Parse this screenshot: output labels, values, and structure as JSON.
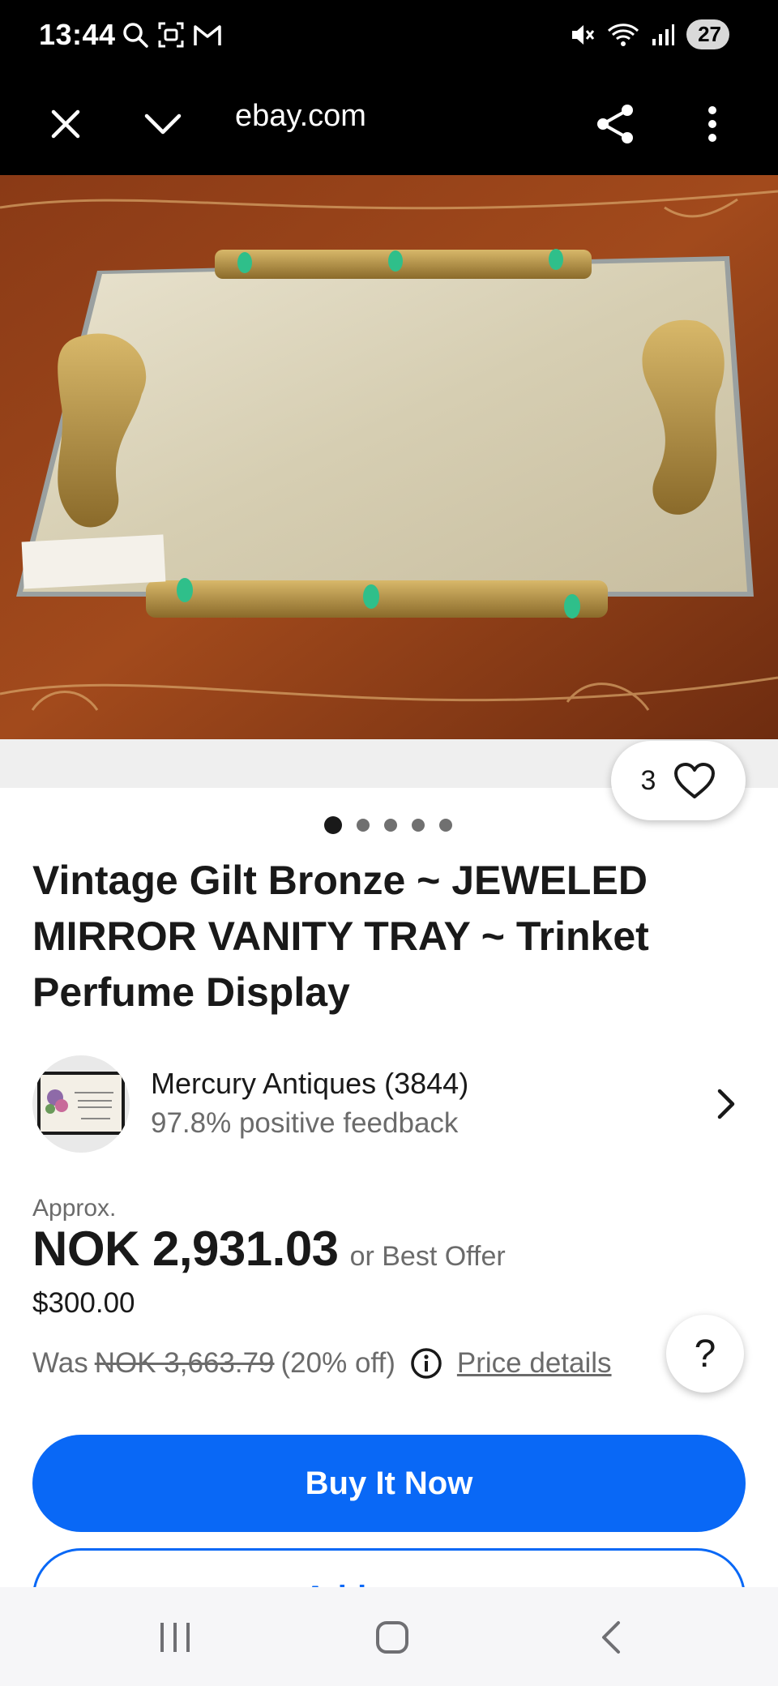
{
  "status_bar": {
    "time": "13:44",
    "battery": "27",
    "icons": [
      "search-icon",
      "screenshot-icon",
      "gmail-icon",
      "mute-icon",
      "wifi-icon",
      "signal-icon"
    ]
  },
  "browser": {
    "url": "ebay.com",
    "icons": [
      "close-icon",
      "chevron-down-icon",
      "share-icon",
      "more-vertical-icon"
    ]
  },
  "listing": {
    "watch_count": "3",
    "image_count": 5,
    "active_image": 1,
    "title": "Vintage Gilt Bronze ~ JEWELED MIRROR VANITY TRAY ~ Trinket Perfume Display",
    "seller": {
      "name": "Mercury Antiques (3844)",
      "feedback": "97.8% positive feedback"
    },
    "price": {
      "approx_label": "Approx.",
      "amount": "NOK 2,931.03",
      "best_offer": "or Best Offer",
      "usd": "$300.00",
      "was_label": "Was",
      "was_amount": "NOK 3,663.79",
      "discount": "(20% off)",
      "details_link": "Price details"
    },
    "help_label": "?",
    "buy_now_label": "Buy It Now",
    "add_to_cart_label": "Add to cart"
  },
  "colors": {
    "primary_blue": "#0968f6",
    "text": "#191919",
    "secondary_text": "#6b6b6b"
  }
}
